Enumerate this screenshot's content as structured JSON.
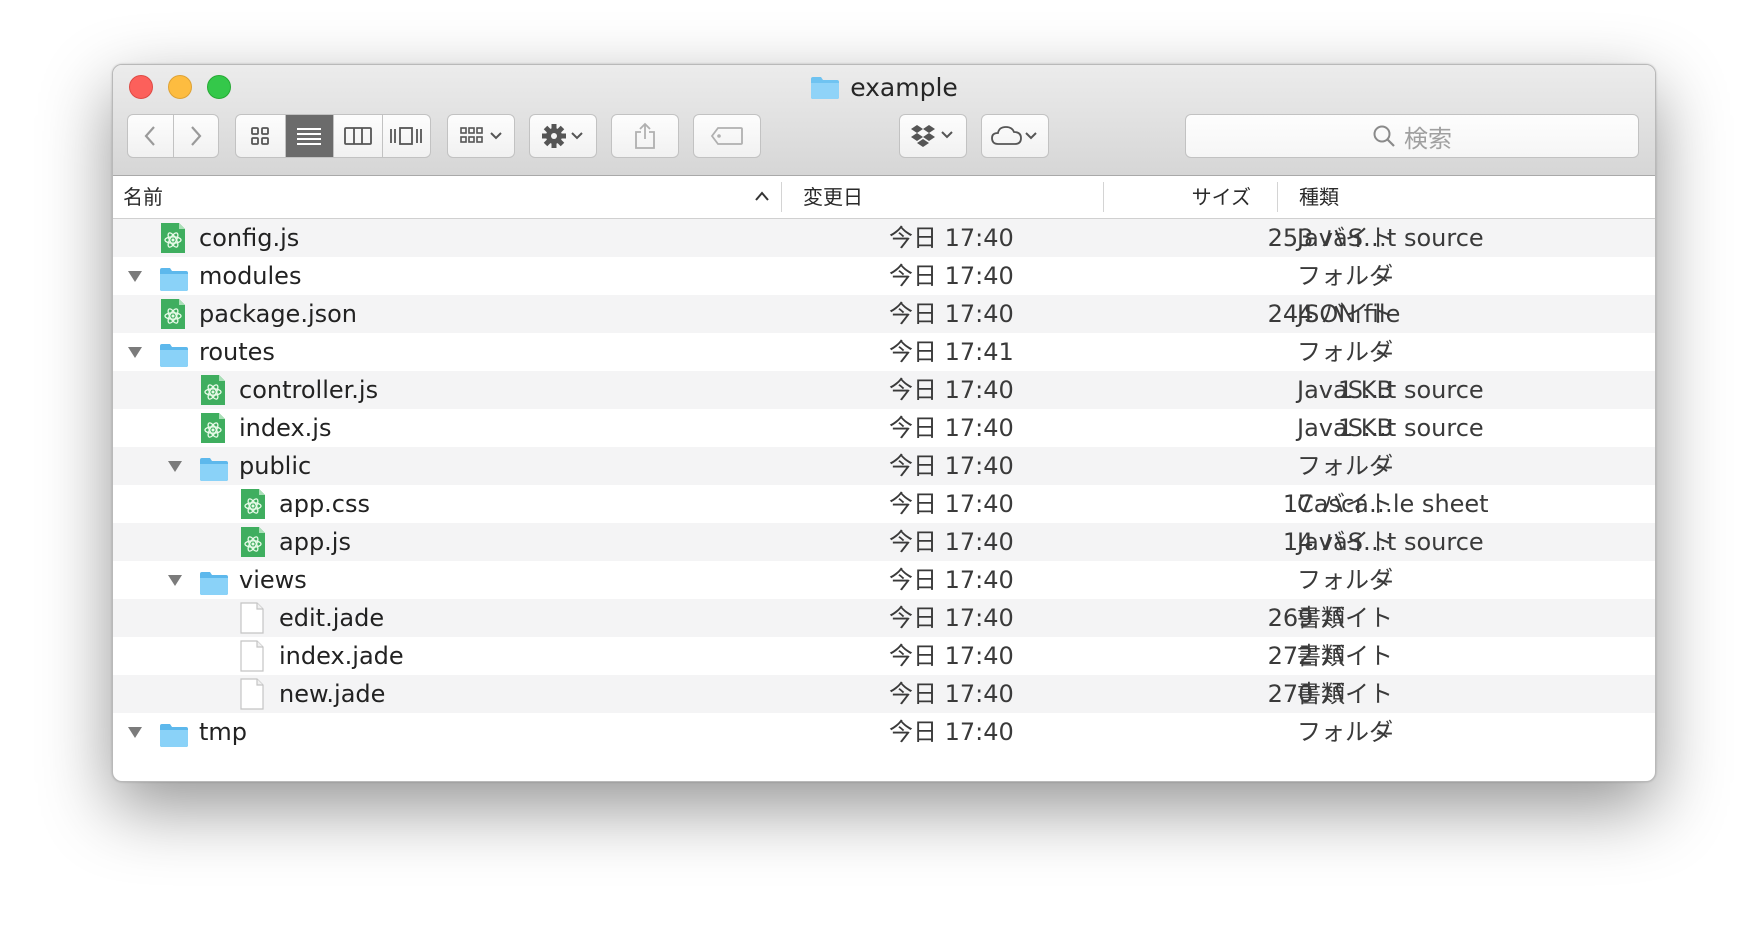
{
  "window": {
    "title": "example",
    "folder_icon": "folder-icon"
  },
  "toolbar": {
    "back": "chevron-left-icon",
    "forward": "chevron-right-icon",
    "views": [
      "icon-view-icon",
      "list-view-icon",
      "column-view-icon",
      "coverflow-view-icon"
    ],
    "arrange": "arrange-icon",
    "action": "gear-icon",
    "share": "share-icon",
    "tags": "tag-icon",
    "dropbox": "dropbox-icon",
    "cloud": "cloud-icon",
    "search_placeholder": "検索"
  },
  "columns": {
    "name": "名前",
    "modified": "変更日",
    "size": "サイズ",
    "kind": "種類"
  },
  "files": [
    {
      "name": "config.js",
      "modified": "今日 17:40",
      "size": "253 バイト",
      "kind": "JavaS…t source",
      "level": 0,
      "type": "atom",
      "disclosure": false
    },
    {
      "name": "modules",
      "modified": "今日 17:40",
      "size": "--",
      "kind": "フォルダ",
      "level": 0,
      "type": "folder",
      "disclosure": true
    },
    {
      "name": "package.json",
      "modified": "今日 17:40",
      "size": "244 バイト",
      "kind": "JSON file",
      "level": 0,
      "type": "atom",
      "disclosure": false
    },
    {
      "name": "routes",
      "modified": "今日 17:41",
      "size": "--",
      "kind": "フォルダ",
      "level": 0,
      "type": "folder",
      "disclosure": true
    },
    {
      "name": "controller.js",
      "modified": "今日 17:40",
      "size": "1 KB",
      "kind": "JavaS…t source",
      "level": 1,
      "type": "atom",
      "disclosure": false
    },
    {
      "name": "index.js",
      "modified": "今日 17:40",
      "size": "1 KB",
      "kind": "JavaS…t source",
      "level": 1,
      "type": "atom",
      "disclosure": false
    },
    {
      "name": "public",
      "modified": "今日 17:40",
      "size": "--",
      "kind": "フォルダ",
      "level": 1,
      "type": "folder",
      "disclosure": true
    },
    {
      "name": "app.css",
      "modified": "今日 17:40",
      "size": "17 バイト",
      "kind": "Casca…le sheet",
      "level": 2,
      "type": "atom",
      "disclosure": false
    },
    {
      "name": "app.js",
      "modified": "今日 17:40",
      "size": "14 バイト",
      "kind": "JavaS…t source",
      "level": 2,
      "type": "atom",
      "disclosure": false
    },
    {
      "name": "views",
      "modified": "今日 17:40",
      "size": "--",
      "kind": "フォルダ",
      "level": 1,
      "type": "folder",
      "disclosure": true
    },
    {
      "name": "edit.jade",
      "modified": "今日 17:40",
      "size": "269 バイト",
      "kind": "書類",
      "level": 2,
      "type": "doc",
      "disclosure": false
    },
    {
      "name": "index.jade",
      "modified": "今日 17:40",
      "size": "272 バイト",
      "kind": "書類",
      "level": 2,
      "type": "doc",
      "disclosure": false
    },
    {
      "name": "new.jade",
      "modified": "今日 17:40",
      "size": "270 バイト",
      "kind": "書類",
      "level": 2,
      "type": "doc",
      "disclosure": false
    },
    {
      "name": "tmp",
      "modified": "今日 17:40",
      "size": "--",
      "kind": "フォルダ",
      "level": 0,
      "type": "folder",
      "disclosure": true
    }
  ],
  "colors": {
    "folder": "#6fc3f1",
    "atom_file": "#3fae5f",
    "selected_view": "#6b6b6b",
    "row_alt": "#f4f4f5"
  }
}
